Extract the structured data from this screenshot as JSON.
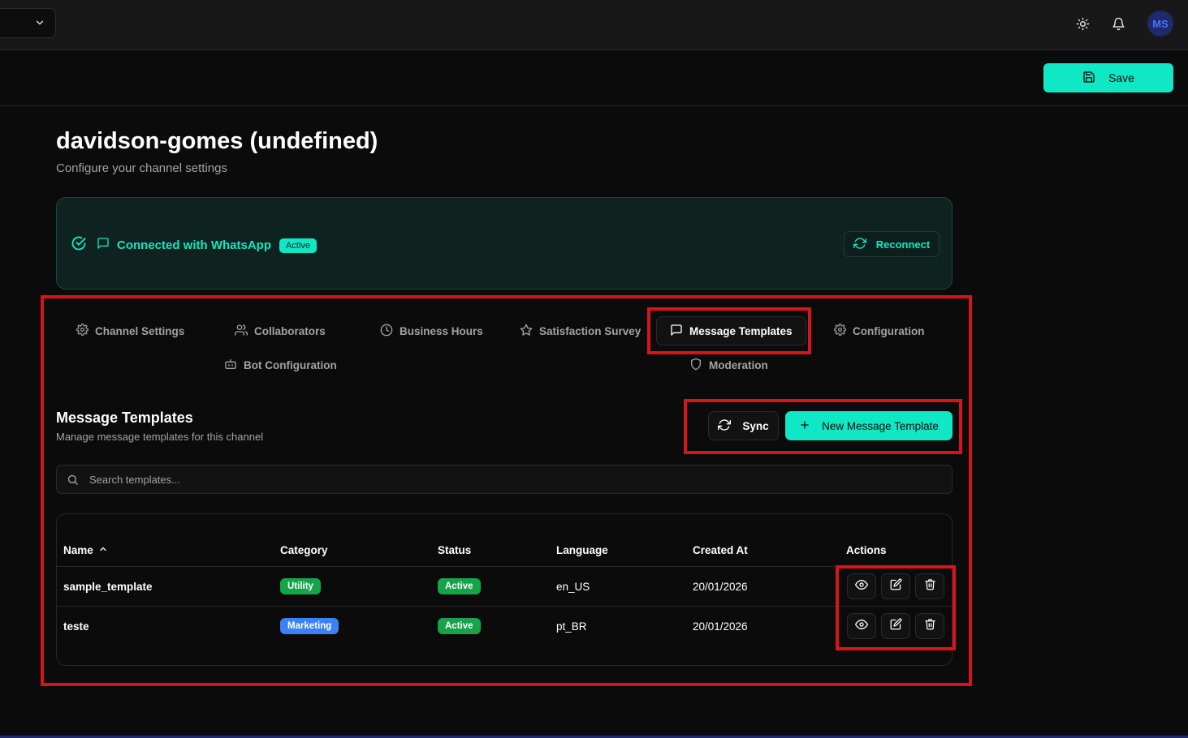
{
  "topbar": {
    "workspace_select_icon": "chevron-down-icon",
    "theme_icon": "sun-icon",
    "notifications_icon": "bell-icon",
    "avatar_initials": "MS"
  },
  "actionbar": {
    "save_label": "Save",
    "save_icon": "save-icon"
  },
  "page": {
    "title": "davidson-gomes (undefined)",
    "subtitle": "Configure your channel settings"
  },
  "connection": {
    "text": "Connected with WhatsApp",
    "badge": "Active",
    "reconnect_label": "Reconnect",
    "accent_color": "#10e7c4"
  },
  "tabs": [
    {
      "label": "Channel Settings",
      "icon": "gear-icon"
    },
    {
      "label": "Collaborators",
      "icon": "users-icon"
    },
    {
      "label": "Business Hours",
      "icon": "clock-icon"
    },
    {
      "label": "Satisfaction Survey",
      "icon": "star-icon"
    },
    {
      "label": "Message Templates",
      "icon": "message-square-icon",
      "active": true
    },
    {
      "label": "Configuration",
      "icon": "gear-icon"
    },
    {
      "label": "Bot Configuration",
      "icon": "bot-icon"
    },
    {
      "label": "Moderation",
      "icon": "shield-icon"
    }
  ],
  "templates": {
    "title": "Message Templates",
    "subtitle": "Manage message templates for this channel",
    "sync_label": "Sync",
    "new_label": "New Message Template",
    "search_placeholder": "Search templates...",
    "columns": [
      "Name",
      "Category",
      "Status",
      "Language",
      "Created At",
      "Actions"
    ],
    "sort_icon": "chevron-up-icon",
    "rows": [
      {
        "name": "sample_template",
        "category": "Utility",
        "status": "Active",
        "language": "en_US",
        "created_at": "20/01/2026"
      },
      {
        "name": "teste",
        "category": "Marketing",
        "status": "Active",
        "language": "pt_BR",
        "created_at": "20/01/2026"
      }
    ],
    "row_actions": [
      "eye-icon",
      "edit-icon",
      "trash-icon"
    ]
  },
  "colors": {
    "accent": "#10e7c4",
    "highlight_outline": "#d7141d",
    "utility_badge": "#16a34a",
    "marketing_badge": "#3b82f6"
  }
}
